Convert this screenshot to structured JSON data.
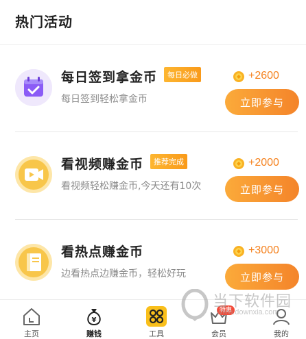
{
  "header": {
    "title": "热门活动"
  },
  "tasks": [
    {
      "title": "每日签到拿金币",
      "badge": "每日必做",
      "desc": "每日签到轻松拿金币",
      "reward": "+2600",
      "button": "立即参与",
      "icon": "calendar-check-icon"
    },
    {
      "title": "看视频赚金币",
      "badge": "推荐完成",
      "desc": "看视频轻松赚金币,今天还有10次",
      "reward": "+2000",
      "button": "立即参与",
      "icon": "video-camera-icon"
    },
    {
      "title": "看热点赚金币",
      "badge": "",
      "desc": "边看热点边赚金币，轻松好玩",
      "reward": "+3000",
      "button": "立即参与",
      "icon": "book-icon"
    }
  ],
  "tabbar": {
    "items": [
      {
        "label": "主页",
        "icon": "home-icon"
      },
      {
        "label": "赚钱",
        "icon": "money-bag-icon"
      },
      {
        "label": "工具",
        "icon": "grid-icon"
      },
      {
        "label": "会员",
        "icon": "crown-icon",
        "badge": "特惠"
      },
      {
        "label": "我的",
        "icon": "user-icon"
      }
    ],
    "active_index": 1
  },
  "watermark": {
    "text": "当下软件园",
    "url": "www.downxia.com"
  },
  "colors": {
    "accent": "#f4842a",
    "reward": "#f5821f",
    "purple": "#8b5cf6",
    "gold": "#f7b529"
  }
}
